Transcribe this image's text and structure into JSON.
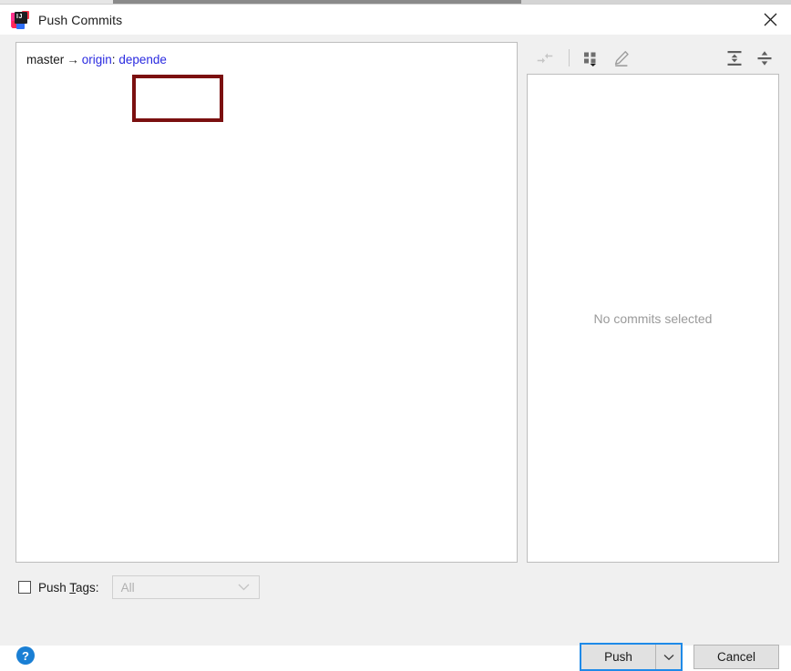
{
  "window": {
    "title": "Push Commits",
    "app_icon": "intellij-idea-icon",
    "close_icon": "close-icon"
  },
  "commit_list": {
    "push_spec": {
      "local_branch": "master",
      "arrow": "→",
      "remote": "origin",
      "separator": ":",
      "remote_branch": "depende"
    },
    "highlight_color": "#7b1010"
  },
  "details_toolbar": {
    "buttons": [
      {
        "name": "collapse-arrows-icon",
        "label": "",
        "enabled": false
      },
      {
        "name": "grid-view-icon",
        "label": "",
        "enabled": true
      },
      {
        "name": "edit-pencil-icon",
        "label": "",
        "enabled": true
      },
      {
        "name": "expand-all-icon",
        "label": "",
        "enabled": true
      },
      {
        "name": "collapse-all-icon",
        "label": "",
        "enabled": true
      }
    ]
  },
  "details_panel": {
    "empty_message": "No commits selected"
  },
  "tags": {
    "checkbox_checked": false,
    "label_prefix": "Push ",
    "label_mnemonic": "T",
    "label_suffix": "ags:",
    "combo_value": "All",
    "combo_enabled": false,
    "combo_arrow_icon": "chevron-down-icon"
  },
  "footer": {
    "help_label": "?",
    "push_label": "Push",
    "push_dropdown_icon": "chevron-down-icon",
    "cancel_label": "Cancel",
    "focus_color": "#1e8ae8"
  }
}
